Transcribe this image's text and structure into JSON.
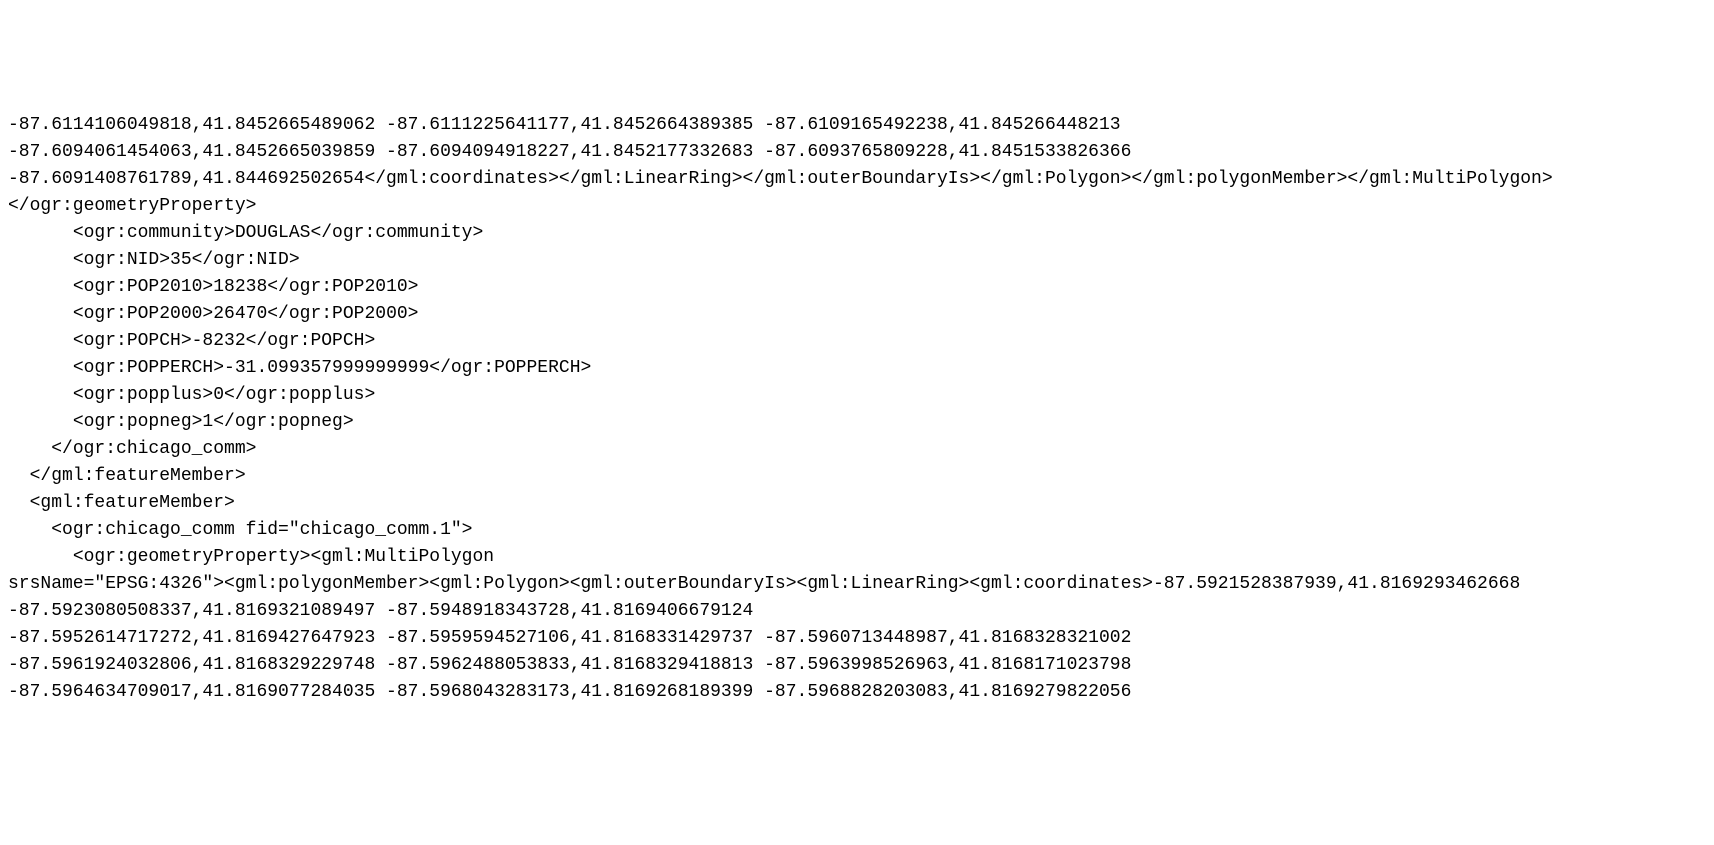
{
  "xml_content": {
    "line1": "-87.6114106049818,41.8452665489062 -87.6111225641177,41.8452664389385 -87.6109165492238,41.845266448213",
    "line2": "-87.6094061454063,41.8452665039859 -87.6094094918227,41.8452177332683 -87.6093765809228,41.8451533826366",
    "line3": "-87.6091408761789,41.844692502654</gml:coordinates></gml:LinearRing></gml:outerBoundaryIs></gml:Polygon></gml:polygonMember></gml:MultiPolygon></ogr:geometryProperty>",
    "line4": "      <ogr:community>DOUGLAS</ogr:community>",
    "line5": "      <ogr:NID>35</ogr:NID>",
    "line6": "      <ogr:POP2010>18238</ogr:POP2010>",
    "line7": "      <ogr:POP2000>26470</ogr:POP2000>",
    "line8": "      <ogr:POPCH>-8232</ogr:POPCH>",
    "line9": "      <ogr:POPPERCH>-31.099357999999999</ogr:POPPERCH>",
    "line10": "      <ogr:popplus>0</ogr:popplus>",
    "line11": "      <ogr:popneg>1</ogr:popneg>",
    "line12": "    </ogr:chicago_comm>",
    "line13": "  </gml:featureMember>",
    "line14": "  <gml:featureMember>",
    "line15": "    <ogr:chicago_comm fid=\"chicago_comm.1\">",
    "line16": "      <ogr:geometryProperty><gml:MultiPolygon",
    "line17": "srsName=\"EPSG:4326\"><gml:polygonMember><gml:Polygon><gml:outerBoundaryIs><gml:LinearRing><gml:coordinates>-87.5921528387939,41.8169293462668 -87.5923080508337,41.8169321089497 -87.5948918343728,41.8169406679124",
    "line18": "-87.5952614717272,41.8169427647923 -87.5959594527106,41.8168331429737 -87.5960713448987,41.8168328321002",
    "line19": "-87.5961924032806,41.8168329229748 -87.5962488053833,41.8168329418813 -87.5963998526963,41.8168171023798",
    "line20": "-87.5964634709017,41.8169077284035 -87.5968043283173,41.8169268189399 -87.5968828203083,41.8169279822056"
  },
  "attributes": {
    "community": "DOUGLAS",
    "NID": "35",
    "POP2010": "18238",
    "POP2000": "26470",
    "POPCH": "-8232",
    "POPPERCH": "-31.099357999999999",
    "popplus": "0",
    "popneg": "1",
    "fid": "chicago_comm.1",
    "srsName": "EPSG:4326"
  }
}
